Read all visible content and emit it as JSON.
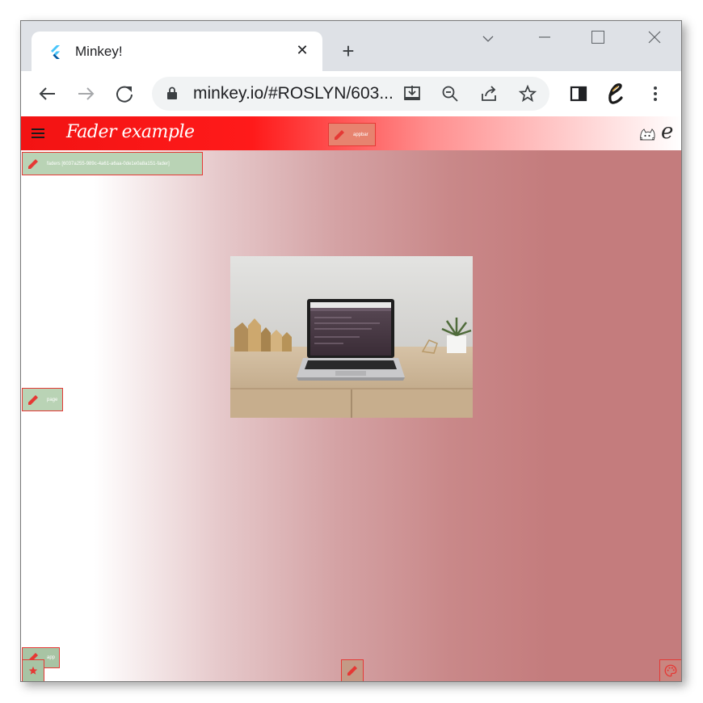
{
  "browser": {
    "tab_title": "Minkey!",
    "url": "minkey.io/#ROSLYN/603...",
    "tab_close_label": "✕",
    "new_tab_label": "+"
  },
  "app": {
    "title": "Fader example",
    "logo_text": "e",
    "tags": {
      "appbar": "appbar",
      "fader": "faders [6037a255-989c-4a61-a6aa-0de1e0a8a151-fader]",
      "page": "page",
      "app": "app"
    },
    "photo_description_icon": "laptop-on-desk-photo"
  },
  "colors": {
    "appbar_start": "#f21313",
    "appbar_end": "#ffffff",
    "page_fade_end": "#c47c7d",
    "edit_border": "#e53935",
    "edit_tag_bg": "#b9d3b5"
  }
}
